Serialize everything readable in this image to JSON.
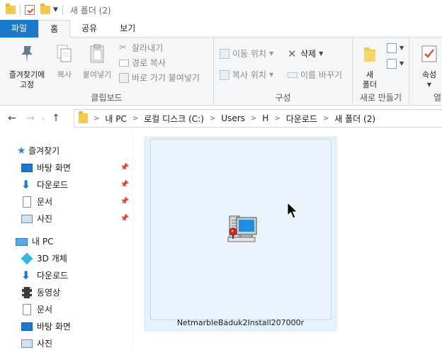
{
  "window": {
    "title": "새 폴더 (2)"
  },
  "tabs": [
    {
      "label": "파일"
    },
    {
      "label": "홈"
    },
    {
      "label": "공유"
    },
    {
      "label": "보기"
    }
  ],
  "ribbon": {
    "clipboard": {
      "label": "클립보드",
      "pin": "즐겨찾기에\n고정",
      "copy": "복사",
      "paste": "붙여넣기",
      "cut": "잘라내기",
      "copy_path": "경로 복사",
      "paste_shortcut": "바로 가기 붙여넣기"
    },
    "organize": {
      "label": "구성",
      "move_to": "이동 위치",
      "copy_to": "복사 위치",
      "delete": "삭제",
      "rename": "이름 바꾸기"
    },
    "new": {
      "label": "새로 만들기",
      "new_folder": "새\n폴더"
    },
    "open": {
      "label": "열",
      "properties": "속성"
    }
  },
  "address": {
    "segments": [
      "내 PC",
      "로컬 디스크 (C:)",
      "Users",
      "H",
      "다운로드",
      "새 폴더 (2)"
    ]
  },
  "navpane": {
    "quick_access": "즐겨찾기",
    "quick_items": [
      "바탕 화면",
      "다운로드",
      "문서",
      "사진"
    ],
    "this_pc": "내 PC",
    "pc_items": [
      "3D 개체",
      "다운로드",
      "동영상",
      "문서",
      "바탕 화면",
      "사진"
    ]
  },
  "content": {
    "file_name": "NetmarbleBaduk2Install207000r"
  },
  "icons": {
    "back": "arrow-left-icon",
    "forward": "arrow-right-icon",
    "up": "arrow-up-icon"
  }
}
